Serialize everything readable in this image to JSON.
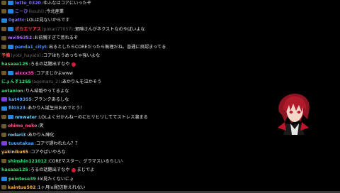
{
  "chat": {
    "messages": [
      {
        "badges": [
          "crown",
          "sub"
        ],
        "name": "lotto_0320",
        "paren": "",
        "name_color": "#7b6cff",
        "text": "ゆふなはコアにいったぞ"
      },
      {
        "badges": [
          "crown",
          "sub"
        ],
        "name": "こーひ",
        "paren": "(kouhi)",
        "name_color": "#7b6cff",
        "text": "今北産業"
      },
      {
        "badges": [
          "sub"
        ],
        "name": "0gattc",
        "paren": "",
        "name_color": "#7b6cff",
        "text": "LOLは見ないからです"
      },
      {
        "badges": [
          "crown",
          "sub"
        ],
        "name": "ポカエリアス",
        "paren": "(pokari77057)",
        "name_color": "#ff4d4d",
        "text": "邪険さんがネクストなのやばいよな"
      },
      {
        "badges": [
          "crown"
        ],
        "name": "mvi96352",
        "paren": "",
        "name_color": "#b06cff",
        "text": "お前親すぎて荒れるぞ"
      },
      {
        "badges": [
          "crown",
          "sub"
        ],
        "name": "panda1_cityt",
        "paren": "",
        "name_color": "#4d8cff",
        "text": "出るとしたらCOREだったら無理だね。普通に良認まってる"
      },
      {
        "badges": [],
        "name": "予備",
        "paren": "(yobi_hayato)",
        "name_color": "#ff4d4d",
        "text": "コアはもうめっちゃ強いよな"
      },
      {
        "badges": [],
        "name": "hasaaa125",
        "paren": "",
        "name_color": "#3cdc78",
        "text": "ろるの話題出すなや",
        "emote": true
      },
      {
        "badges": [
          "crown",
          "sub"
        ],
        "name": "aixxx35",
        "paren": "",
        "name_color": "#ff4dd2",
        "text": "コアまじかよwww"
      },
      {
        "badges": [],
        "name": "にょんす1255",
        "paren": "(agomaru_2)",
        "name_color": "#3cdc78",
        "text": "あかりんを泣かそう"
      },
      {
        "badges": [],
        "name": "aotanion",
        "paren": "",
        "name_color": "#3cdc78",
        "text": "りん結婚やってるよな"
      },
      {
        "badges": [
          "prime"
        ],
        "name": "kat49355",
        "paren": "",
        "name_color": "#4da6ff",
        "text": "ブランクあるしな"
      },
      {
        "badges": [
          "sub"
        ],
        "name": "fil0323",
        "paren": "",
        "name_color": "#4da6ff",
        "text": "あかりん誕生日おめでとう！"
      },
      {
        "badges": [
          "crown",
          "sub"
        ],
        "name": "nmwater",
        "paren": "",
        "name_color": "#6fd0ff",
        "text": "LOLよく分かんねーのにヒリヒリしててストレス溜まる"
      },
      {
        "badges": [
          "crown"
        ],
        "name": "ohime_neko",
        "paren": "",
        "name_color": "#ff5c8a",
        "text": "笑"
      },
      {
        "badges": [
          "crown"
        ],
        "name": "rodari3",
        "paren": "",
        "name_color": "#6fd0ff",
        "text": "あかりん陣化"
      },
      {
        "badges": [
          "prime"
        ],
        "name": "tuuutakaa",
        "paren": "",
        "name_color": "#4da6ff",
        "text": "コアで誘われたん？？"
      },
      {
        "badges": [],
        "name": "yakiniku65",
        "paren": "",
        "name_color": "#ffb347",
        "text": "コアやばいやろな"
      },
      {
        "badges": [
          "crown"
        ],
        "name": "shinshin121012",
        "paren": "",
        "name_color": "#3cdc78",
        "text": "COREマスター、グラマスいるらしい"
      },
      {
        "badges": [],
        "name": "hasaaa125",
        "paren": "",
        "name_color": "#3cdc78",
        "text": "ろるの話題出すなや",
        "emote": true,
        "text_after": "まじでよ"
      },
      {
        "badges": [
          "sub"
        ],
        "name": "peintese39",
        "paren": "",
        "name_color": "#3cdc78",
        "text": "lol見たくないにょ"
      },
      {
        "badges": [
          "crown"
        ],
        "name": "kaintuu582",
        "paren": "",
        "name_color": "#ffb347",
        "text": "1ヶ月lol配信耐えれない"
      }
    ]
  },
  "colors": {
    "background": "#000000",
    "message_text": "#e8e8e8",
    "paren_text": "#6b6b6b"
  },
  "avatar": {
    "icon": "vtuber-avatar-icon"
  }
}
